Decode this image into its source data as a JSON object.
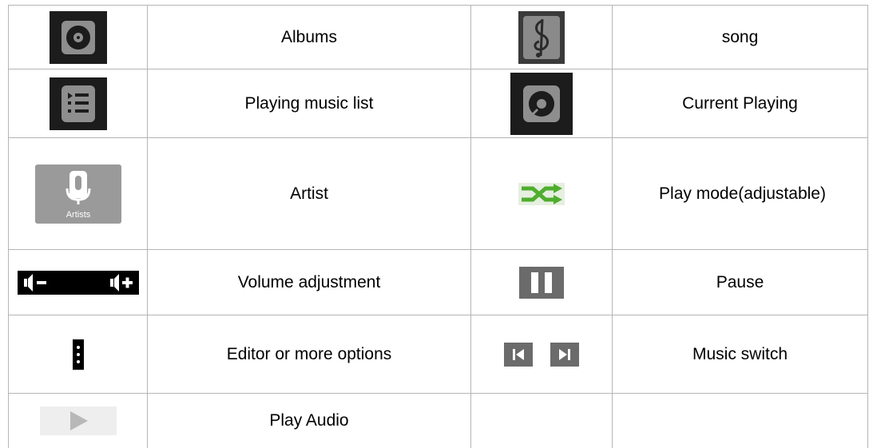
{
  "rows": [
    {
      "left_icon": "album-disc-icon",
      "left_label": "Albums",
      "right_icon": "music-note-icon",
      "right_label": "song"
    },
    {
      "left_icon": "playlist-icon",
      "left_label": "Playing music list",
      "right_icon": "now-playing-icon",
      "right_label": "Current Playing"
    },
    {
      "left_icon": "artist-mic-icon",
      "left_label": "Artist",
      "left_icon_caption": "Artists",
      "right_icon": "shuffle-icon",
      "right_label": "Play mode(adjustable)"
    },
    {
      "left_icon": "volume-icons",
      "left_label": "Volume adjustment",
      "right_icon": "pause-icon",
      "right_label": "Pause"
    },
    {
      "left_icon": "more-options-icon",
      "left_label": "Editor or more options",
      "right_icon": "prev-next-icons",
      "right_label": "Music switch"
    },
    {
      "left_icon": "play-icon",
      "left_label": "Play Audio",
      "right_icon": "",
      "right_label": ""
    }
  ],
  "colors": {
    "dark_tile": "#1c1c1c",
    "gray_tile": "#8a8a8a",
    "artist_tile": "#9a9a9a",
    "shuffle_green": "#4fae2e",
    "border": "#b5b5b5"
  }
}
